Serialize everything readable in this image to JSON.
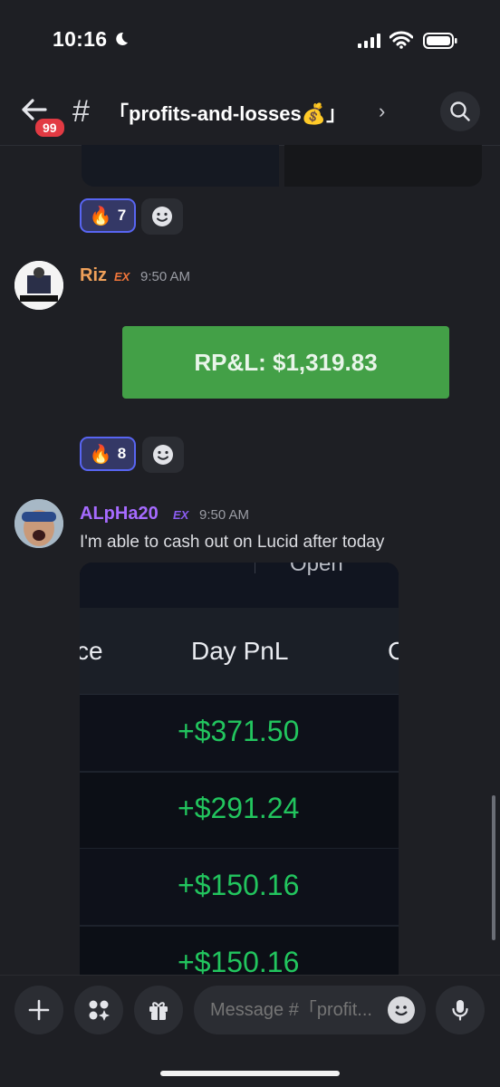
{
  "status_bar": {
    "time": "10:16"
  },
  "header": {
    "unread_badge": "99",
    "hash": "#",
    "channel_name": "「profits-and-losses💰」",
    "chevron": "›"
  },
  "reactions_1": {
    "emoji": "🔥",
    "count": "7"
  },
  "message_riz": {
    "username": "Riz",
    "tag": "EX",
    "time": "9:50 AM",
    "button_label": "RP&L: $1,319.83"
  },
  "reactions_2": {
    "emoji": "🔥",
    "count": "8"
  },
  "message_alpha": {
    "username": "ALpHa20",
    "tag": "EX",
    "time": "9:50 AM",
    "text": "I'm able to cash out on Lucid after today"
  },
  "pnl_image": {
    "top_text": "Open",
    "col_left": "ce",
    "col_header": "Day PnL",
    "col_right": "C",
    "rows": [
      "+$371.50",
      "+$291.24",
      "+$150.16",
      "+$150.16"
    ]
  },
  "composer": {
    "placeholder": "Message #「profit..."
  },
  "colors": {
    "accent": "#5865f2",
    "green_button": "#43a047",
    "pnl_green": "#22c55e",
    "riz_name": "#f0a15a",
    "alpha_name": "#a66bff"
  }
}
